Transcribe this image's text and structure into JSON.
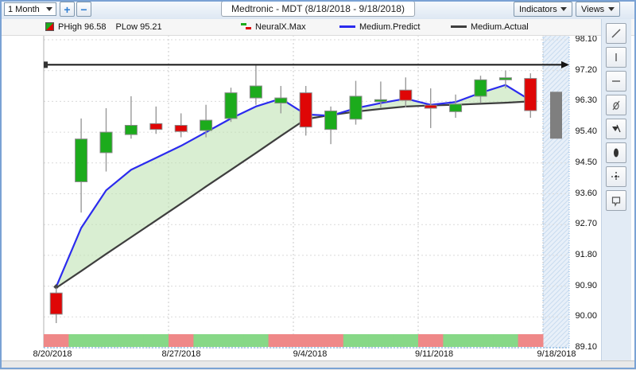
{
  "window": {
    "title": "Medtronic - MDT (8/18/2018 - 9/18/2018)"
  },
  "toolbar": {
    "range_value": "1 Month",
    "zoom_in_label": "+",
    "zoom_out_label": "−",
    "indicators_label": "Indicators",
    "views_label": "Views"
  },
  "legend": {
    "phigh": "PHigh 96.58",
    "plow": "PLow 95.21",
    "neuralx": "NeuralX.Max",
    "predict": "Medium.Predict",
    "actual": "Medium.Actual"
  },
  "side_toolbar": {
    "tools": [
      "trend-line",
      "vertical-line",
      "horizontal-line",
      "pencil-off",
      "pen",
      "ellipse",
      "crosshair",
      "callout"
    ]
  },
  "colors": {
    "candle_up": "#1cab1c",
    "candle_down": "#df0606",
    "predict_line": "#2b2bee",
    "actual_line": "#3e3e3e",
    "band_fill": "#bfe3b4",
    "sentiment_green": "#87d887",
    "sentiment_red": "#ef8888",
    "prediction_bar": "#7f7f7f",
    "annotation": "#141414"
  },
  "chart_data": {
    "type": "candlestick",
    "title": "Medtronic - MDT (8/18/2018 - 9/18/2018)",
    "symbol": "MDT",
    "date_range": "8/18/2018 - 9/18/2018",
    "phigh": 96.58,
    "plow": 95.21,
    "annotation_line_price": 97.37,
    "y_axis": {
      "min": 89.1,
      "max": 98.1,
      "ticks": [
        98.1,
        97.2,
        96.3,
        95.4,
        94.5,
        93.6,
        92.7,
        91.8,
        90.9,
        90.0,
        89.1
      ]
    },
    "x_axis": {
      "ticks": [
        "8/20/2018",
        "8/27/2018",
        "9/4/2018",
        "9/11/2018",
        "9/18/2018"
      ]
    },
    "candles": [
      {
        "date": "8/20/2018",
        "o": 90.7,
        "h": 90.85,
        "l": 89.82,
        "c": 90.08
      },
      {
        "date": "8/21/2018",
        "o": 93.95,
        "h": 95.8,
        "l": 93.05,
        "c": 95.2
      },
      {
        "date": "8/22/2018",
        "o": 94.8,
        "h": 96.1,
        "l": 94.25,
        "c": 95.4
      },
      {
        "date": "8/23/2018",
        "o": 95.33,
        "h": 96.45,
        "l": 95.21,
        "c": 95.6
      },
      {
        "date": "8/24/2018",
        "o": 95.65,
        "h": 96.15,
        "l": 95.35,
        "c": 95.48
      },
      {
        "date": "8/27/2018",
        "o": 95.6,
        "h": 95.95,
        "l": 95.25,
        "c": 95.42
      },
      {
        "date": "8/28/2018",
        "o": 95.45,
        "h": 96.2,
        "l": 95.25,
        "c": 95.75
      },
      {
        "date": "8/29/2018",
        "o": 95.8,
        "h": 96.7,
        "l": 95.7,
        "c": 96.55
      },
      {
        "date": "8/30/2018",
        "o": 96.4,
        "h": 97.35,
        "l": 96.2,
        "c": 96.75
      },
      {
        "date": "8/31/2018",
        "o": 96.25,
        "h": 96.75,
        "l": 95.95,
        "c": 96.4
      },
      {
        "date": "9/4/2018",
        "o": 96.55,
        "h": 96.75,
        "l": 95.3,
        "c": 95.55
      },
      {
        "date": "9/5/2018",
        "o": 95.48,
        "h": 96.15,
        "l": 95.05,
        "c": 96.02
      },
      {
        "date": "9/6/2018",
        "o": 95.78,
        "h": 96.9,
        "l": 95.62,
        "c": 96.45
      },
      {
        "date": "9/7/2018",
        "o": 96.31,
        "h": 96.88,
        "l": 96.12,
        "c": 96.35
      },
      {
        "date": "9/10/2018",
        "o": 96.63,
        "h": 97.0,
        "l": 96.12,
        "c": 96.33
      },
      {
        "date": "9/11/2018",
        "o": 96.19,
        "h": 96.68,
        "l": 95.52,
        "c": 96.1
      },
      {
        "date": "9/12/2018",
        "o": 96.0,
        "h": 96.5,
        "l": 95.82,
        "c": 96.22
      },
      {
        "date": "9/13/2018",
        "o": 96.45,
        "h": 97.05,
        "l": 96.25,
        "c": 96.93
      },
      {
        "date": "9/14/2018",
        "o": 96.93,
        "h": 97.2,
        "l": 96.68,
        "c": 96.99
      },
      {
        "date": "9/17/2018",
        "o": 96.97,
        "h": 97.12,
        "l": 95.82,
        "c": 96.03
      }
    ],
    "series": [
      {
        "name": "Medium.Predict",
        "color": "#2b2bee",
        "values": [
          90.88,
          92.6,
          93.7,
          94.3,
          94.65,
          95.0,
          95.4,
          95.8,
          96.15,
          96.38,
          95.92,
          95.88,
          96.1,
          96.25,
          96.38,
          96.2,
          96.28,
          96.55,
          96.78,
          96.33
        ]
      },
      {
        "name": "Medium.Actual",
        "color": "#3e3e3e",
        "values": [
          90.85,
          91.34,
          91.84,
          92.33,
          92.82,
          93.31,
          93.81,
          94.3,
          94.79,
          95.29,
          95.78,
          95.9,
          96.0,
          96.08,
          96.15,
          96.18,
          96.2,
          96.23,
          96.26,
          96.3
        ]
      }
    ],
    "prediction_bar": {
      "date": "9/18/2018",
      "high": 96.58,
      "low": 95.21
    },
    "sentiment": [
      "red",
      "green",
      "green",
      "green",
      "green",
      "red",
      "green",
      "green",
      "green",
      "red",
      "red",
      "red",
      "green",
      "green",
      "green",
      "red",
      "green",
      "green",
      "green",
      "red"
    ]
  }
}
